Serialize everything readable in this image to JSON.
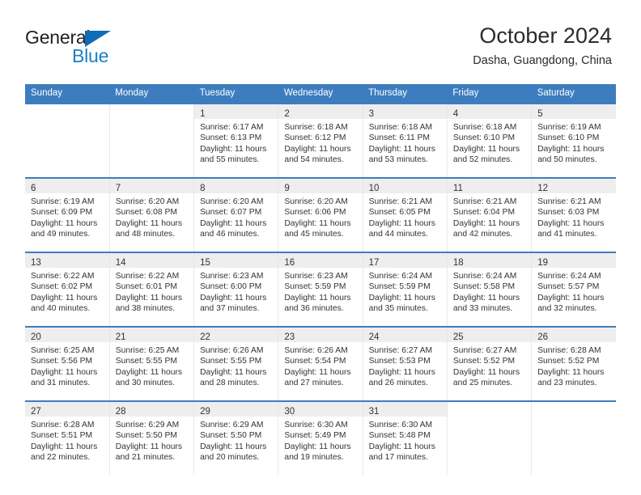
{
  "brand": {
    "name_top": "General",
    "name_bottom": "Blue",
    "triangle_color": "#0f6cb6",
    "blue_text_color": "#1b7fc4"
  },
  "header": {
    "month_title": "October 2024",
    "location": "Dasha, Guangdong, China"
  },
  "theme": {
    "header_row_bg": "#3d7dbf",
    "header_row_text": "#ffffff",
    "daynum_band_bg": "#eeeeee",
    "row_divider": "#3d7dbf"
  },
  "calendar": {
    "weekday_headers": [
      "Sunday",
      "Monday",
      "Tuesday",
      "Wednesday",
      "Thursday",
      "Friday",
      "Saturday"
    ],
    "labels": {
      "sunrise_prefix": "Sunrise:",
      "sunset_prefix": "Sunset:",
      "daylight_prefix": "Daylight:"
    },
    "weeks": [
      [
        {
          "day": "",
          "sunrise": "",
          "sunset": "",
          "daylight_line1": "",
          "daylight_line2": ""
        },
        {
          "day": "",
          "sunrise": "",
          "sunset": "",
          "daylight_line1": "",
          "daylight_line2": ""
        },
        {
          "day": "1",
          "sunrise": "Sunrise: 6:17 AM",
          "sunset": "Sunset: 6:13 PM",
          "daylight_line1": "Daylight: 11 hours",
          "daylight_line2": "and 55 minutes."
        },
        {
          "day": "2",
          "sunrise": "Sunrise: 6:18 AM",
          "sunset": "Sunset: 6:12 PM",
          "daylight_line1": "Daylight: 11 hours",
          "daylight_line2": "and 54 minutes."
        },
        {
          "day": "3",
          "sunrise": "Sunrise: 6:18 AM",
          "sunset": "Sunset: 6:11 PM",
          "daylight_line1": "Daylight: 11 hours",
          "daylight_line2": "and 53 minutes."
        },
        {
          "day": "4",
          "sunrise": "Sunrise: 6:18 AM",
          "sunset": "Sunset: 6:10 PM",
          "daylight_line1": "Daylight: 11 hours",
          "daylight_line2": "and 52 minutes."
        },
        {
          "day": "5",
          "sunrise": "Sunrise: 6:19 AM",
          "sunset": "Sunset: 6:10 PM",
          "daylight_line1": "Daylight: 11 hours",
          "daylight_line2": "and 50 minutes."
        }
      ],
      [
        {
          "day": "6",
          "sunrise": "Sunrise: 6:19 AM",
          "sunset": "Sunset: 6:09 PM",
          "daylight_line1": "Daylight: 11 hours",
          "daylight_line2": "and 49 minutes."
        },
        {
          "day": "7",
          "sunrise": "Sunrise: 6:20 AM",
          "sunset": "Sunset: 6:08 PM",
          "daylight_line1": "Daylight: 11 hours",
          "daylight_line2": "and 48 minutes."
        },
        {
          "day": "8",
          "sunrise": "Sunrise: 6:20 AM",
          "sunset": "Sunset: 6:07 PM",
          "daylight_line1": "Daylight: 11 hours",
          "daylight_line2": "and 46 minutes."
        },
        {
          "day": "9",
          "sunrise": "Sunrise: 6:20 AM",
          "sunset": "Sunset: 6:06 PM",
          "daylight_line1": "Daylight: 11 hours",
          "daylight_line2": "and 45 minutes."
        },
        {
          "day": "10",
          "sunrise": "Sunrise: 6:21 AM",
          "sunset": "Sunset: 6:05 PM",
          "daylight_line1": "Daylight: 11 hours",
          "daylight_line2": "and 44 minutes."
        },
        {
          "day": "11",
          "sunrise": "Sunrise: 6:21 AM",
          "sunset": "Sunset: 6:04 PM",
          "daylight_line1": "Daylight: 11 hours",
          "daylight_line2": "and 42 minutes."
        },
        {
          "day": "12",
          "sunrise": "Sunrise: 6:21 AM",
          "sunset": "Sunset: 6:03 PM",
          "daylight_line1": "Daylight: 11 hours",
          "daylight_line2": "and 41 minutes."
        }
      ],
      [
        {
          "day": "13",
          "sunrise": "Sunrise: 6:22 AM",
          "sunset": "Sunset: 6:02 PM",
          "daylight_line1": "Daylight: 11 hours",
          "daylight_line2": "and 40 minutes."
        },
        {
          "day": "14",
          "sunrise": "Sunrise: 6:22 AM",
          "sunset": "Sunset: 6:01 PM",
          "daylight_line1": "Daylight: 11 hours",
          "daylight_line2": "and 38 minutes."
        },
        {
          "day": "15",
          "sunrise": "Sunrise: 6:23 AM",
          "sunset": "Sunset: 6:00 PM",
          "daylight_line1": "Daylight: 11 hours",
          "daylight_line2": "and 37 minutes."
        },
        {
          "day": "16",
          "sunrise": "Sunrise: 6:23 AM",
          "sunset": "Sunset: 5:59 PM",
          "daylight_line1": "Daylight: 11 hours",
          "daylight_line2": "and 36 minutes."
        },
        {
          "day": "17",
          "sunrise": "Sunrise: 6:24 AM",
          "sunset": "Sunset: 5:59 PM",
          "daylight_line1": "Daylight: 11 hours",
          "daylight_line2": "and 35 minutes."
        },
        {
          "day": "18",
          "sunrise": "Sunrise: 6:24 AM",
          "sunset": "Sunset: 5:58 PM",
          "daylight_line1": "Daylight: 11 hours",
          "daylight_line2": "and 33 minutes."
        },
        {
          "day": "19",
          "sunrise": "Sunrise: 6:24 AM",
          "sunset": "Sunset: 5:57 PM",
          "daylight_line1": "Daylight: 11 hours",
          "daylight_line2": "and 32 minutes."
        }
      ],
      [
        {
          "day": "20",
          "sunrise": "Sunrise: 6:25 AM",
          "sunset": "Sunset: 5:56 PM",
          "daylight_line1": "Daylight: 11 hours",
          "daylight_line2": "and 31 minutes."
        },
        {
          "day": "21",
          "sunrise": "Sunrise: 6:25 AM",
          "sunset": "Sunset: 5:55 PM",
          "daylight_line1": "Daylight: 11 hours",
          "daylight_line2": "and 30 minutes."
        },
        {
          "day": "22",
          "sunrise": "Sunrise: 6:26 AM",
          "sunset": "Sunset: 5:55 PM",
          "daylight_line1": "Daylight: 11 hours",
          "daylight_line2": "and 28 minutes."
        },
        {
          "day": "23",
          "sunrise": "Sunrise: 6:26 AM",
          "sunset": "Sunset: 5:54 PM",
          "daylight_line1": "Daylight: 11 hours",
          "daylight_line2": "and 27 minutes."
        },
        {
          "day": "24",
          "sunrise": "Sunrise: 6:27 AM",
          "sunset": "Sunset: 5:53 PM",
          "daylight_line1": "Daylight: 11 hours",
          "daylight_line2": "and 26 minutes."
        },
        {
          "day": "25",
          "sunrise": "Sunrise: 6:27 AM",
          "sunset": "Sunset: 5:52 PM",
          "daylight_line1": "Daylight: 11 hours",
          "daylight_line2": "and 25 minutes."
        },
        {
          "day": "26",
          "sunrise": "Sunrise: 6:28 AM",
          "sunset": "Sunset: 5:52 PM",
          "daylight_line1": "Daylight: 11 hours",
          "daylight_line2": "and 23 minutes."
        }
      ],
      [
        {
          "day": "27",
          "sunrise": "Sunrise: 6:28 AM",
          "sunset": "Sunset: 5:51 PM",
          "daylight_line1": "Daylight: 11 hours",
          "daylight_line2": "and 22 minutes."
        },
        {
          "day": "28",
          "sunrise": "Sunrise: 6:29 AM",
          "sunset": "Sunset: 5:50 PM",
          "daylight_line1": "Daylight: 11 hours",
          "daylight_line2": "and 21 minutes."
        },
        {
          "day": "29",
          "sunrise": "Sunrise: 6:29 AM",
          "sunset": "Sunset: 5:50 PM",
          "daylight_line1": "Daylight: 11 hours",
          "daylight_line2": "and 20 minutes."
        },
        {
          "day": "30",
          "sunrise": "Sunrise: 6:30 AM",
          "sunset": "Sunset: 5:49 PM",
          "daylight_line1": "Daylight: 11 hours",
          "daylight_line2": "and 19 minutes."
        },
        {
          "day": "31",
          "sunrise": "Sunrise: 6:30 AM",
          "sunset": "Sunset: 5:48 PM",
          "daylight_line1": "Daylight: 11 hours",
          "daylight_line2": "and 17 minutes."
        },
        {
          "day": "",
          "sunrise": "",
          "sunset": "",
          "daylight_line1": "",
          "daylight_line2": ""
        },
        {
          "day": "",
          "sunrise": "",
          "sunset": "",
          "daylight_line1": "",
          "daylight_line2": ""
        }
      ]
    ]
  }
}
